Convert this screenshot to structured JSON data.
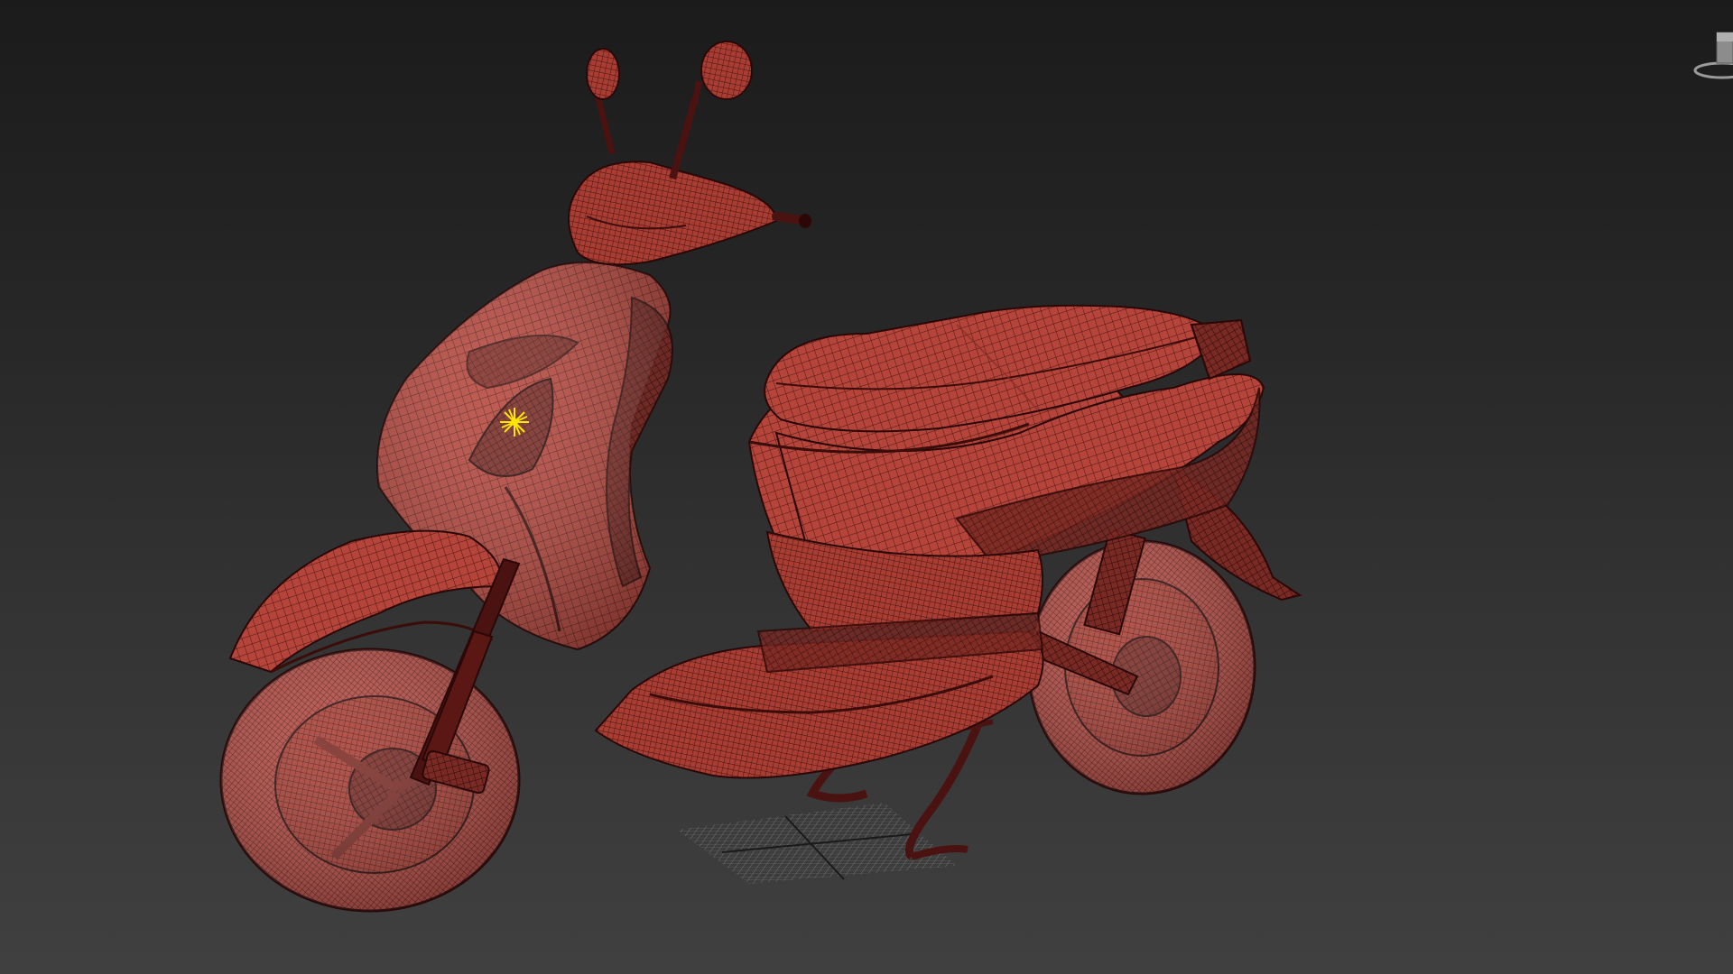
{
  "viewport": {
    "background_top": "#1b1b1b",
    "background_bottom": "#404040",
    "shading_mode": "wireframe-on-shaded"
  },
  "model": {
    "object": "scooter",
    "mesh_color": "#b5453b",
    "wire_color": "#3a0c0a",
    "highlight_color": "#e36a5c"
  },
  "light_gizmo": {
    "icon": "light-sun-icon",
    "color": "#ffe600"
  },
  "ground_grid": {
    "color": "#9a9a9a",
    "axis_color": "#1a1a1a"
  },
  "viewcube": {
    "icon": "viewcube-icon",
    "color": "#9a9a9a"
  }
}
